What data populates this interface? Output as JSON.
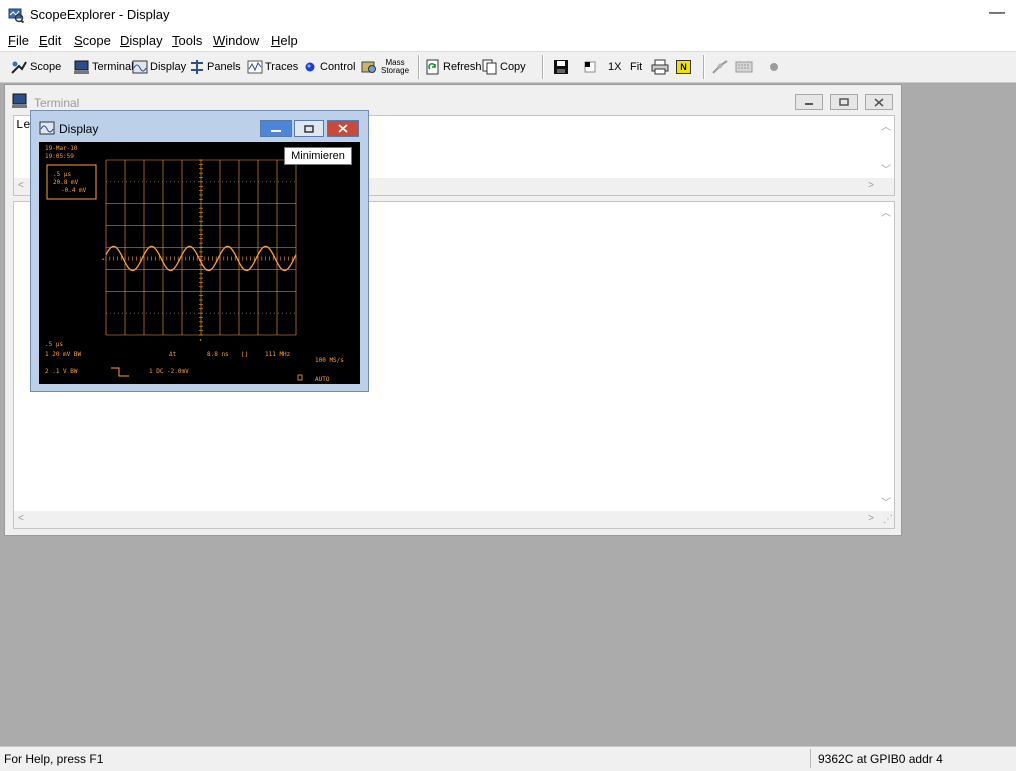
{
  "window": {
    "title": "ScopeExplorer - Display",
    "minimize_glyph": "—"
  },
  "menu": {
    "items": [
      {
        "key": "F",
        "rest": "ile"
      },
      {
        "key": "E",
        "rest": "dit"
      },
      {
        "key": "S",
        "rest": "cope"
      },
      {
        "key": "D",
        "rest": "isplay"
      },
      {
        "key": "T",
        "rest": "ools"
      },
      {
        "key": "W",
        "rest": "indow"
      },
      {
        "key": "H",
        "rest": "elp"
      }
    ]
  },
  "toolbar": {
    "scope": "Scope",
    "terminal": "Terminal",
    "display": "Display",
    "panels": "Panels",
    "traces": "Traces",
    "control": "Control",
    "mass_storage_1": "Mass",
    "mass_storage_2": "Storage",
    "refresh": "Refresh",
    "copy": "Copy",
    "zoom_1x": "1X",
    "fit": "Fit",
    "n_badge": "N"
  },
  "terminal": {
    "title": "Terminal",
    "text": "Le"
  },
  "display": {
    "title": "Display",
    "tooltip": "Minimieren",
    "scope": {
      "date": "19-Mar-10",
      "time": "19:05:59",
      "box_line1": ".5 µs",
      "box_line2": "20.8 mV",
      "box_line3": "-0.4 mV",
      "timebase": ".5 µs",
      "ch1_scale": "1  20 mV  BW",
      "dt_label": "Δt",
      "dt_value": "8.8 ns",
      "freq_value": "111 MHz",
      "sample_rate": "100 MS/s",
      "ch2_scale": "2 .1  V  BW",
      "trigger": "1  DC -2.0mV",
      "mode": "AUTO"
    },
    "wave": {
      "amplitude_div": 0.55,
      "cycles": 5,
      "center_div": 4.5
    }
  },
  "status": {
    "help": "For Help, press F1",
    "connection": "9362C at GPIB0 addr 4"
  }
}
